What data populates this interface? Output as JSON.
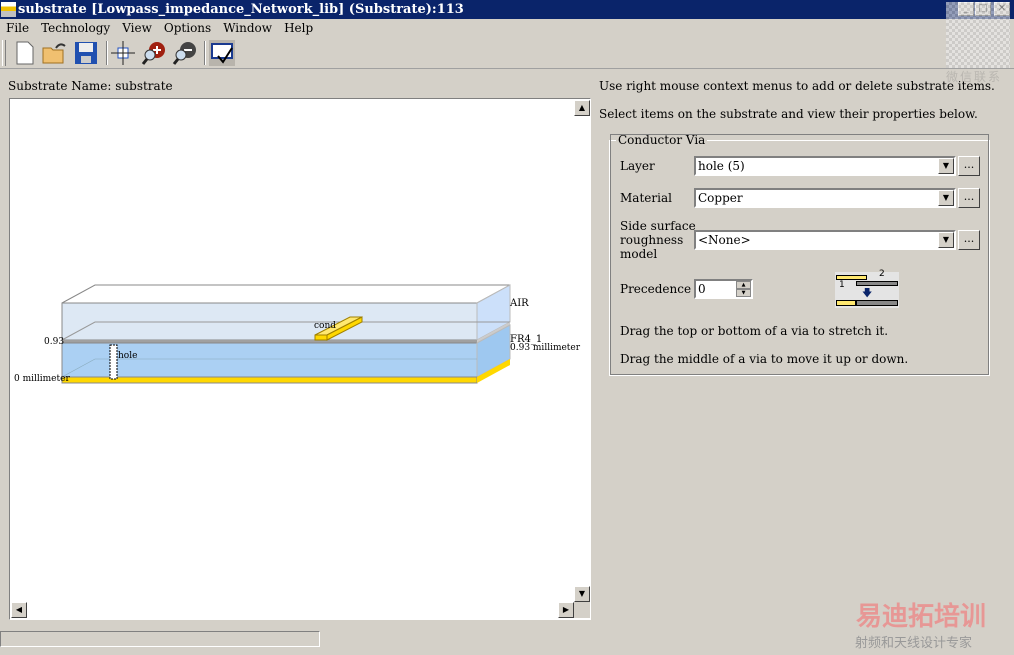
{
  "window": {
    "title": "substrate [Lowpass_impedance_Network_lib] (Substrate):113",
    "minimize": "_",
    "maximize": "□",
    "close": "✕"
  },
  "menu": [
    "File",
    "Technology",
    "View",
    "Options",
    "Window",
    "Help"
  ],
  "toolbar": {
    "icons": [
      "new-icon",
      "open-icon",
      "save-icon",
      "view-all-icon",
      "zoom-in-icon",
      "zoom-out-icon",
      "check-icon"
    ]
  },
  "left": {
    "substrate_name_label": "Substrate Name:",
    "substrate_name": "substrate"
  },
  "diagram": {
    "air": "AIR",
    "fr4": "FR4_1",
    "fr4_thickness": "0.93 millimeter",
    "top_level": "0.93",
    "bottom_level": "0 millimeter",
    "cond": "cond",
    "hole": "hole",
    "colors": {
      "air": "#dde8f4",
      "fr4": "#abd0f3",
      "conductor": "#ffd800",
      "separator": "#a0a0a0"
    }
  },
  "right": {
    "hint1": "Use right mouse context menus to add or delete substrate items.",
    "hint2": "Select items on the substrate and view their properties below.",
    "group_title": "Conductor Via",
    "layer_label": "Layer",
    "layer_value": "hole (5)",
    "material_label": "Material",
    "material_value": "Copper",
    "roughness_label_1": "Side surface",
    "roughness_label_2": "roughness",
    "roughness_label_3": "model",
    "roughness_value": "<None>",
    "precedence_label": "Precedence",
    "precedence_value": "0",
    "browse": "...",
    "drag_hint1": "Drag the top or bottom of a via to stretch it.",
    "drag_hint2": "Drag the middle of a via to move it up or down.",
    "prec_icon_1": "1",
    "prec_icon_2": "2"
  },
  "watermark": {
    "qr": "微信联系",
    "brand": "易迪拓培训",
    "slogan": "射频和天线设计专家"
  }
}
